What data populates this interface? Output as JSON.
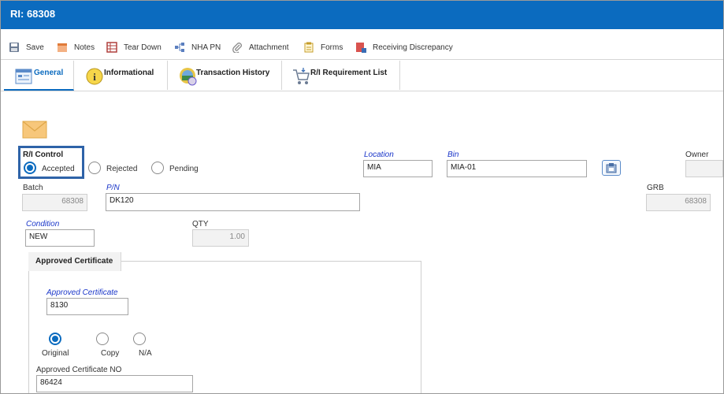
{
  "window": {
    "title": "RI: 68308"
  },
  "toolbar": {
    "save": "Save",
    "notes": "Notes",
    "tear_down": "Tear Down",
    "nha_pn": "NHA PN",
    "attachment": "Attachment",
    "forms": "Forms",
    "receiving_discrepancy": "Receiving Discrepancy"
  },
  "tabs": {
    "general": "General",
    "informational": "Informational",
    "transaction_history": "Transaction History",
    "requirement_list": "R/I Requirement List"
  },
  "ri_control": {
    "label": "R/I Control",
    "accepted": "Accepted",
    "rejected": "Rejected",
    "pending": "Pending",
    "selected": "Accepted"
  },
  "location": {
    "label": "Location",
    "value": "MIA"
  },
  "bin": {
    "label": "Bin",
    "value": "MIA-01"
  },
  "owner": {
    "label": "Owner",
    "value": ""
  },
  "batch": {
    "label": "Batch",
    "value": "68308"
  },
  "pn": {
    "label": "P/N",
    "value": "DK120"
  },
  "grb": {
    "label": "GRB",
    "value": "68308"
  },
  "condition": {
    "label": "Condition",
    "value": "NEW"
  },
  "qty": {
    "label": "QTY",
    "value": "1.00"
  },
  "approved_cert": {
    "section_title": "Approved Certificate",
    "label": "Approved Certificate",
    "value": "8130",
    "original": "Original",
    "copy": "Copy",
    "na": "N/A",
    "selected": "Original",
    "no_label": "Approved Certificate NO",
    "no_value": "86424"
  },
  "colors": {
    "accent": "#0b6bbf",
    "required_label": "#1a36c9"
  }
}
